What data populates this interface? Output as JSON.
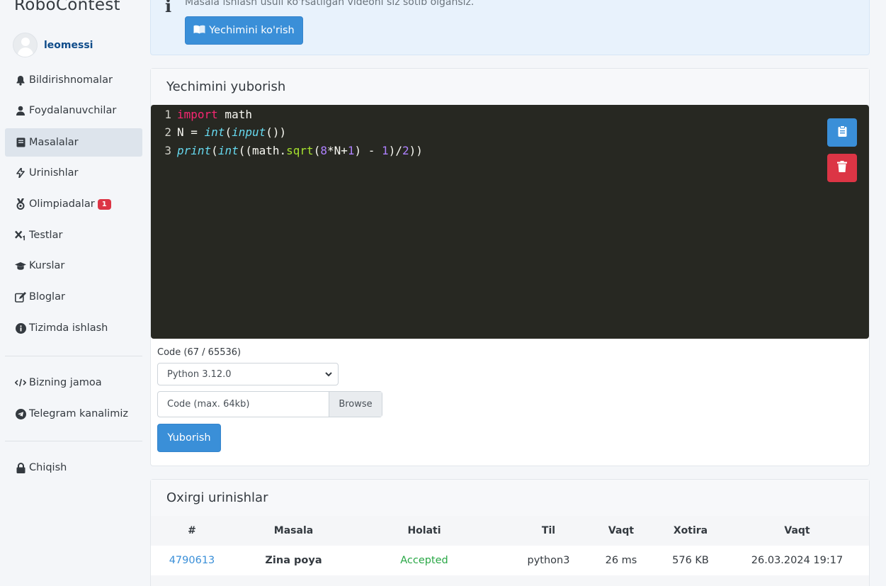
{
  "brand": "RoboContest",
  "user": {
    "name": "leomessi"
  },
  "sidebar": {
    "items": [
      {
        "label": "Bildirishnomalar",
        "icon": "bell-icon"
      },
      {
        "label": "Foydalanuvchilar",
        "icon": "user-icon"
      },
      {
        "label": "Masalalar",
        "icon": "book-icon",
        "active": true
      },
      {
        "label": "Urinishlar",
        "icon": "activity-icon"
      },
      {
        "label": "Olimpiadalar",
        "icon": "medal-icon",
        "badge": "1"
      },
      {
        "label": "Testlar",
        "icon": "subscript-icon"
      },
      {
        "label": "Kurslar",
        "icon": "graduation-cap-icon"
      },
      {
        "label": "Bloglar",
        "icon": "pencil-icon"
      },
      {
        "label": "Tizimda ishlash",
        "icon": "info-icon"
      }
    ],
    "extra": [
      {
        "label": "Bizning jamoa",
        "icon": "code-icon"
      },
      {
        "label": "Telegram kanalimiz",
        "icon": "telegram-icon"
      }
    ],
    "logout": {
      "label": "Chiqish",
      "icon": "lock-icon"
    }
  },
  "info": {
    "text": "Masala ishlash usuli ko'rsatilgan videoni siz sotib olgansiz.",
    "button": "Yechimini ko'rish"
  },
  "submit_section": {
    "title": "Yechimini yuborish",
    "code_lines": [
      {
        "n": "1",
        "tokens": [
          {
            "t": "import",
            "c": "kw"
          },
          {
            "t": " math",
            "c": ""
          }
        ]
      },
      {
        "n": "2",
        "tokens": [
          {
            "t": "N = ",
            "c": ""
          },
          {
            "t": "int",
            "c": "fn"
          },
          {
            "t": "(",
            "c": ""
          },
          {
            "t": "input",
            "c": "fn"
          },
          {
            "t": "())",
            "c": ""
          }
        ]
      },
      {
        "n": "3",
        "tokens": [
          {
            "t": "print",
            "c": "fn"
          },
          {
            "t": "(",
            "c": ""
          },
          {
            "t": "int",
            "c": "fn"
          },
          {
            "t": "((math.",
            "c": ""
          },
          {
            "t": "sqrt",
            "c": "meth"
          },
          {
            "t": "(",
            "c": ""
          },
          {
            "t": "8",
            "c": "num"
          },
          {
            "t": "*N+",
            "c": ""
          },
          {
            "t": "1",
            "c": "num"
          },
          {
            "t": ") - ",
            "c": ""
          },
          {
            "t": "1",
            "c": "num"
          },
          {
            "t": ")/",
            "c": ""
          },
          {
            "t": "2",
            "c": "num"
          },
          {
            "t": "))",
            "c": ""
          }
        ]
      }
    ],
    "code_label": "Code (67 / 65536)",
    "language": "Python 3.12.0",
    "file_placeholder": "Code (max. 64kb)",
    "browse_label": "Browse",
    "submit_label": "Yuborish"
  },
  "attempts": {
    "title": "Oxirgi urinishlar",
    "columns": [
      "#",
      "Masala",
      "Holati",
      "Til",
      "Vaqt",
      "Xotira",
      "Vaqt"
    ],
    "rows": [
      {
        "id": "4790613",
        "problem": "Zina poya",
        "status": "Accepted",
        "lang": "python3",
        "time": "26 ms",
        "memory": "576 KB",
        "date": "26.03.2024 19:17"
      }
    ]
  },
  "colors": {
    "accent": "#3a8fd8",
    "danger": "#dc3545",
    "success": "#28a745",
    "editor_bg": "#272822"
  }
}
